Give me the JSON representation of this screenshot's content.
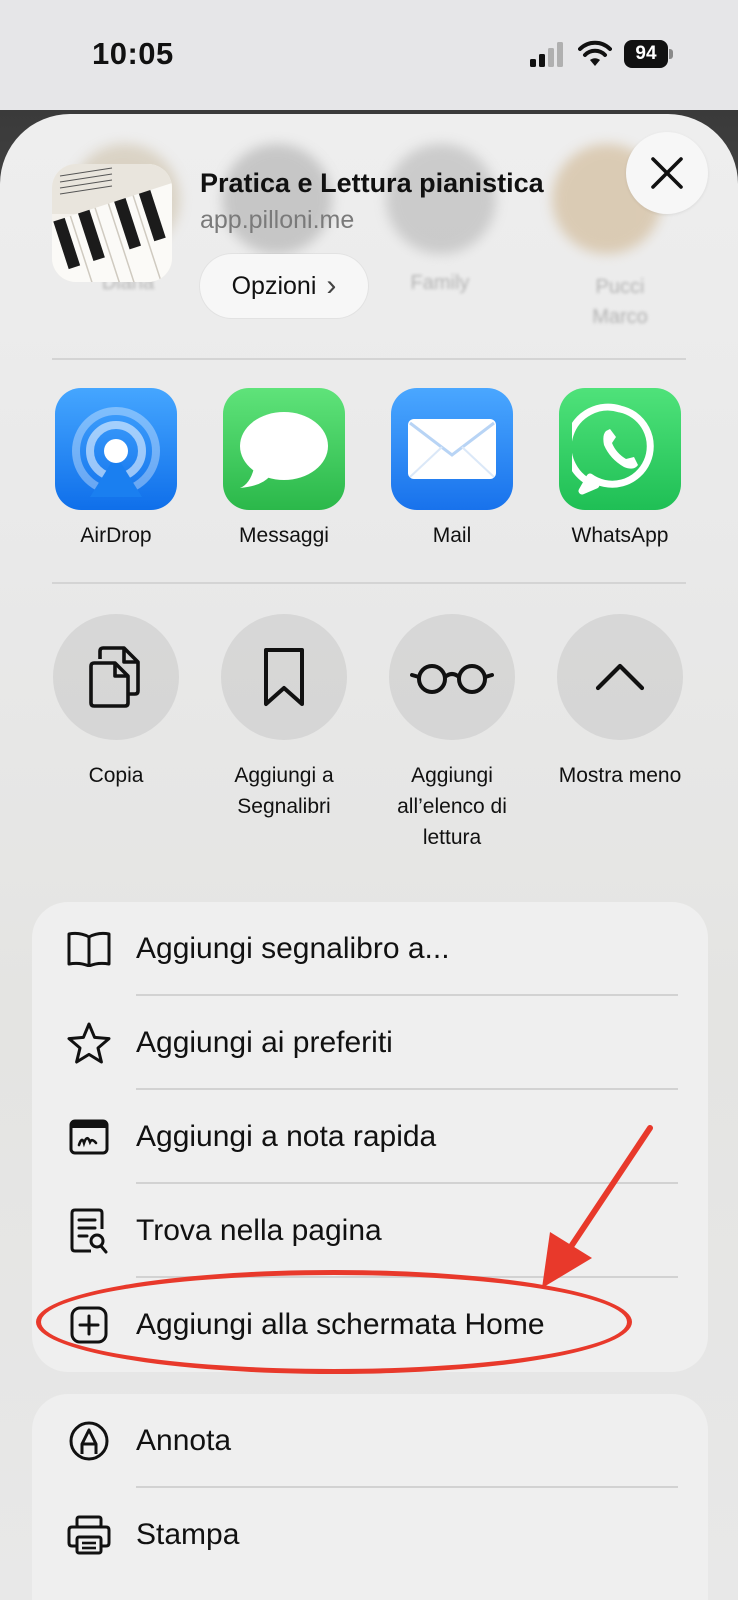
{
  "status_bar": {
    "time": "10:05",
    "battery": "94"
  },
  "background_contacts": [
    "Diana",
    "Family",
    "Pucci\nMarco"
  ],
  "header": {
    "title": "Pratica e Lettura pianistica",
    "url": "app.pilloni.me",
    "options_label": "Opzioni",
    "options_chevron": "›"
  },
  "share_targets": [
    {
      "label": "AirDrop",
      "icon": "airdrop-icon"
    },
    {
      "label": "Messaggi",
      "icon": "messages-icon"
    },
    {
      "label": "Mail",
      "icon": "mail-icon"
    },
    {
      "label": "WhatsApp",
      "icon": "whatsapp-icon"
    }
  ],
  "actions": [
    {
      "label": "Copia",
      "icon": "copy-icon"
    },
    {
      "label": "Aggiungi a\nSegnalibri",
      "icon": "bookmark-icon"
    },
    {
      "label": "Aggiungi\nall’elenco di\nlettura",
      "icon": "glasses-icon"
    },
    {
      "label": "Mostra meno",
      "icon": "chevron-up-icon"
    }
  ],
  "menu_group_1": [
    {
      "label": "Aggiungi segnalibro a...",
      "icon": "book-icon"
    },
    {
      "label": "Aggiungi ai preferiti",
      "icon": "star-icon"
    },
    {
      "label": "Aggiungi a nota rapida",
      "icon": "quick-note-icon"
    },
    {
      "label": "Trova nella pagina",
      "icon": "find-in-page-icon"
    },
    {
      "label": "Aggiungi alla schermata Home",
      "icon": "add-square-icon"
    }
  ],
  "menu_group_2": [
    {
      "label": "Annota",
      "icon": "markup-icon"
    },
    {
      "label": "Stampa",
      "icon": "printer-icon"
    }
  ],
  "colors": {
    "annotation_red": "#e8392b",
    "airdrop_blue": "#1a84f5",
    "messages_green": "#34c759",
    "mail_blue": "#2a8cf7",
    "whatsapp_green": "#25d366"
  }
}
